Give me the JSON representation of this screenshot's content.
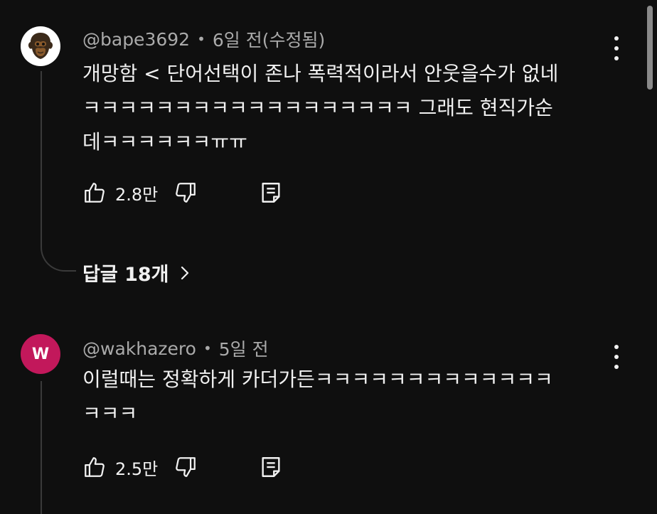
{
  "comments": [
    {
      "author": "@bape3692",
      "time": "6일 전(수정됨)",
      "text_lines": [
        "개망함 < 단어선택이 존나 폭력적이라서 안웃을수가 없네",
        "ㅋㅋㅋㅋㅋㅋㅋㅋㅋㅋㅋㅋㅋㅋㅋㅋㅋㅋ 그래도 현직가순",
        "데ㅋㅋㅋㅋㅋㅋㅠㅠ"
      ],
      "likes": "2.8만",
      "replies_label": "답글 18개",
      "avatar_icon": "bape-ape-logo-icon"
    },
    {
      "author": "@wakhazero",
      "time": "5일 전",
      "text_lines": [
        "이럴때는 정확하게 카더가든ㅋㅋㅋㅋㅋㅋㅋㅋㅋㅋㅋㅋㅋ",
        "ㅋㅋㅋ"
      ],
      "likes": "2.5만",
      "avatar_letter": "W",
      "avatar_color": "#c2185b"
    }
  ],
  "icons": {
    "like": "thumbs-up-icon",
    "dislike": "thumbs-down-icon",
    "reply": "reply-comment-icon",
    "more": "more-vertical-icon",
    "chevron": "chevron-right-icon"
  },
  "colors": {
    "background": "#0f0f0f",
    "text": "#f1f1f1",
    "meta": "#aaaaaa"
  }
}
